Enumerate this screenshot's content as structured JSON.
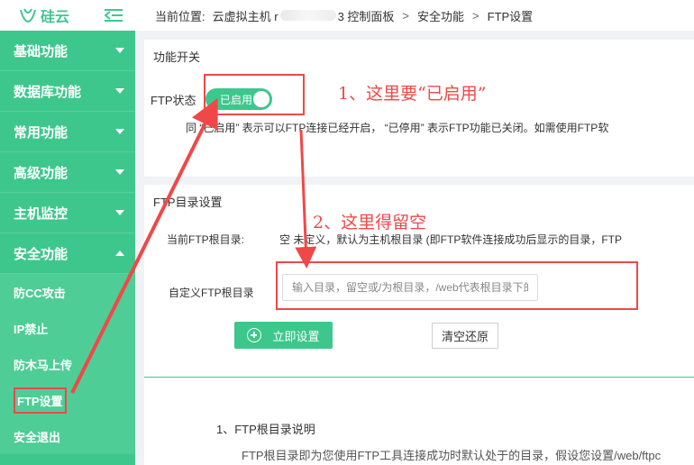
{
  "sidebar": {
    "logo_text": "硅云",
    "menu": [
      {
        "label": "基础功能",
        "expanded": false
      },
      {
        "label": "数据库功能",
        "expanded": false
      },
      {
        "label": "常用功能",
        "expanded": false
      },
      {
        "label": "高级功能",
        "expanded": false
      },
      {
        "label": "主机监控",
        "expanded": false
      },
      {
        "label": "安全功能",
        "expanded": true
      }
    ],
    "submenu": [
      {
        "label": "防CC攻击"
      },
      {
        "label": "IP禁止"
      },
      {
        "label": "防木马上传"
      },
      {
        "label": "FTP设置",
        "active": true
      },
      {
        "label": "安全退出"
      }
    ]
  },
  "breadcrumb": {
    "prefix": "当前位置:",
    "item1": "云虚拟主机 r",
    "item1_tail": "3 控制面板",
    "sep": ">",
    "item2": "安全功能",
    "item3": "FTP设置"
  },
  "switch_panel": {
    "title": "功能开关",
    "status_label": "FTP状态",
    "toggle_label": "已启用",
    "toggle_on": true,
    "note": "同 “已启用” 表示可以FTP连接已经开启， “已停用” 表示FTP功能已关闭。如需使用FTP软"
  },
  "dir_panel": {
    "title": "FTP目录设置",
    "root_label": "当前FTP根目录:",
    "root_value": "空   未定义，默认为主机根目录 (即FTP软件连接成功后显示的目录，FTP",
    "custom_label": "自定义FTP根目录",
    "input_value": "",
    "input_placeholder": "输入目录，留空或/为根目录，/web代表根目录下的web目录",
    "set_button": "立即设置",
    "clear_button": "清空还原"
  },
  "help": {
    "heading": "1、FTP根目录说明",
    "text": "FTP根目录即为您使用FTP工具连接成功时默认处于的目录，假设您设置/web/ftpc"
  },
  "annotations": {
    "a1": "1、这里要“已启用”",
    "a2": "2、这里得留空"
  },
  "colors": {
    "brand": "#3ec78d",
    "annotation": "#f04848"
  }
}
